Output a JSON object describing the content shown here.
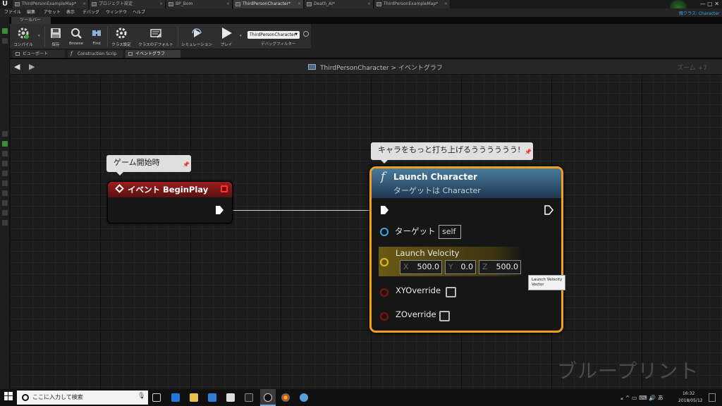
{
  "titlebar": {
    "tabs": [
      {
        "label": "ThirdPersonExampleMap*",
        "active": false
      },
      {
        "label": "プロジェクト設定",
        "active": false
      },
      {
        "label": "BP_Bom",
        "active": false
      },
      {
        "label": "ThirdPersonCharacter*",
        "active": true
      },
      {
        "label": "Death_AI*",
        "active": false
      },
      {
        "label": "ThirdPersonExampleMap*",
        "active": false
      }
    ],
    "window_buttons": "—  ▢  ✕"
  },
  "menubar": {
    "items": [
      "ファイル",
      "編集",
      "アセット",
      "表示",
      "デバッグ",
      "ウィンドウ",
      "ヘルプ"
    ],
    "parent_class_label": "親クラス: Character"
  },
  "toolbar": {
    "tab_label": "ツールバー",
    "buttons": [
      {
        "label": "コンパイル",
        "icon": "compile-icon"
      },
      {
        "label": "保存",
        "icon": "save-icon"
      },
      {
        "label": "Browse",
        "icon": "browse-icon"
      },
      {
        "label": "Find",
        "icon": "find-icon"
      },
      {
        "label": "クラス設定",
        "icon": "class-settings-icon"
      },
      {
        "label": "クラスのデフォルト",
        "icon": "class-defaults-icon"
      },
      {
        "label": "シミュレーション",
        "icon": "simulation-icon"
      },
      {
        "label": "プレイ",
        "icon": "play-icon"
      }
    ],
    "debug_select": "ThirdPersonCharacter",
    "debug_filter_label": "デバッグフィルター"
  },
  "editor_tabs": [
    {
      "label": "ビューポート",
      "active": false
    },
    {
      "label": "Construction Scrip",
      "active": false
    },
    {
      "label": "イベントグラフ",
      "active": true
    }
  ],
  "graph": {
    "breadcrumb": "ThirdPersonCharacter > イベントグラフ",
    "zoom": "ズーム +7",
    "watermark": "ブループリント"
  },
  "comments": {
    "event_comment": "ゲーム開始時",
    "launch_comment": "キャラをもっと打ち上げるうううううう!"
  },
  "event_node": {
    "title": "イベント BeginPlay"
  },
  "launch_node": {
    "title": "Launch Character",
    "subtitle": "ターゲットは Character",
    "target_label": "ターゲット",
    "target_value": "self",
    "velocity_label": "Launch Velocity",
    "velocity": {
      "x_axis": "X",
      "x": "500.0",
      "y_axis": "Y",
      "y": "0.0",
      "z_axis": "Z",
      "z": "500.0"
    },
    "xy_override_label": "XYOverride",
    "z_override_label": "ZOverride",
    "colors": {
      "accent": "#f0a020",
      "target_pin": "#3aa6e8",
      "vector_pin": "#e8b820",
      "bool_pin": "#8a1010"
    }
  },
  "tooltip": {
    "line1": "Launch Velocity",
    "line2": "Vector"
  },
  "taskbar": {
    "search_placeholder": "ここに入力して検索",
    "tray": "𝔁  ^  ▭  ⌨  🔊  あ",
    "time": "16:32",
    "date": "2018/05/12"
  }
}
